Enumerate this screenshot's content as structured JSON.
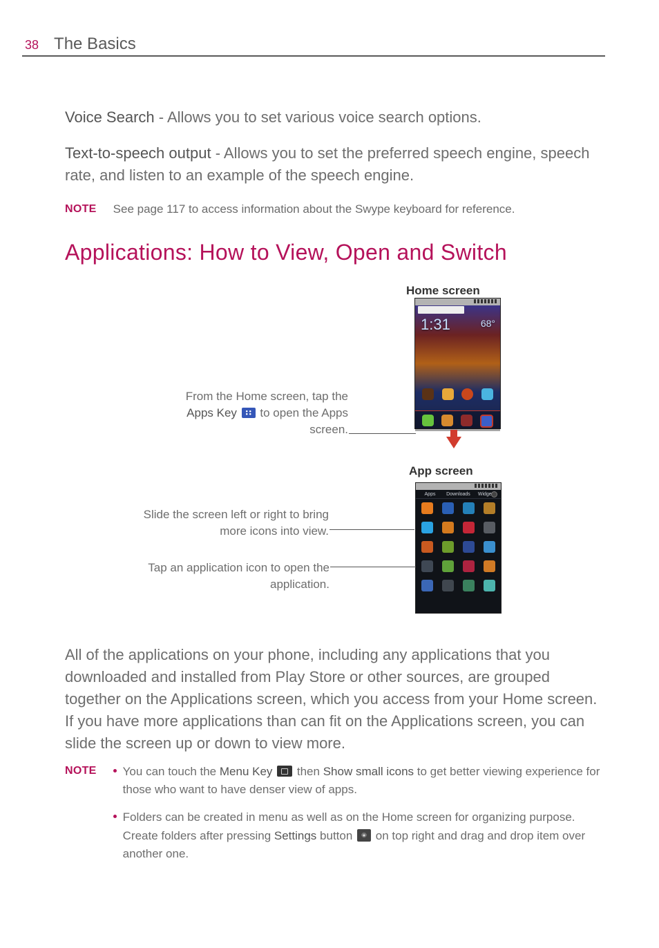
{
  "header": {
    "page_number": "38",
    "title": "The Basics"
  },
  "intro": {
    "voice_search_label": "Voice Search",
    "voice_search_desc": " - Allows you to set various voice search options.",
    "tts_label": "Text-to-speech output",
    "tts_desc": " - Allows you to set the preferred speech engine, speech rate, and listen to an example of the speech engine."
  },
  "note1": {
    "label": "NOTE",
    "text": "See page 117 to access information about the Swype keyboard for reference."
  },
  "h2": "Applications: How to View, Open and Switch",
  "figure": {
    "home_caption": "Home screen",
    "app_caption": "App screen",
    "callout1_pre": "From the Home screen, tap the ",
    "callout1_bold": "Apps Key",
    "callout1_post": " to open the Apps screen.",
    "callout2": "Slide the screen left or right to bring more icons into view.",
    "callout3": "Tap an application icon to open the application.",
    "home_time": "1:31",
    "home_temp": "68",
    "app_tabs": [
      "Apps",
      "Downloads",
      "Widgets"
    ]
  },
  "body": "All of the applications on your phone, including any applications that you downloaded and installed from Play Store or other sources, are grouped together on the Applications screen, which you access from your Home screen. If you have more applications than can fit on the Applications screen, you can slide the screen up or down to view more.",
  "notes2": {
    "label": "NOTE",
    "item1_pre": "You can touch the ",
    "item1_bold1": "Menu Key",
    "item1_mid": " then ",
    "item1_bold2": "Show small icons",
    "item1_post": " to get better viewing experience for those who want to have denser view of apps.",
    "item2_pre": "Folders can be created in menu as well as on the Home screen for organizing purpose. Create folders after pressing ",
    "item2_bold": "Settings",
    "item2_mid": " button ",
    "item2_post": " on top right and drag and drop item over another one."
  },
  "app_icons": [
    {
      "bg": "#e77c1e",
      "lb": ""
    },
    {
      "bg": "#2a5fb4",
      "lb": ""
    },
    {
      "bg": "#2480b8",
      "lb": ""
    },
    {
      "bg": "#b47e28",
      "lb": ""
    },
    {
      "bg": "#2aa2e2",
      "lb": ""
    },
    {
      "bg": "#d47a1e",
      "lb": ""
    },
    {
      "bg": "#c42637",
      "lb": ""
    },
    {
      "bg": "#585c63",
      "lb": ""
    },
    {
      "bg": "#c95a20",
      "lb": ""
    },
    {
      "bg": "#6d9c2b",
      "lb": ""
    },
    {
      "bg": "#2d4a95",
      "lb": ""
    },
    {
      "bg": "#3a8fce",
      "lb": ""
    },
    {
      "bg": "#3f4854",
      "lb": ""
    },
    {
      "bg": "#5fa23a",
      "lb": ""
    },
    {
      "bg": "#ae2340",
      "lb": ""
    },
    {
      "bg": "#d07a25",
      "lb": ""
    },
    {
      "bg": "#3b67b6",
      "lb": ""
    },
    {
      "bg": "#40474f",
      "lb": ""
    },
    {
      "bg": "#3a815e",
      "lb": ""
    },
    {
      "bg": "#4cb4ad",
      "lb": ""
    }
  ]
}
